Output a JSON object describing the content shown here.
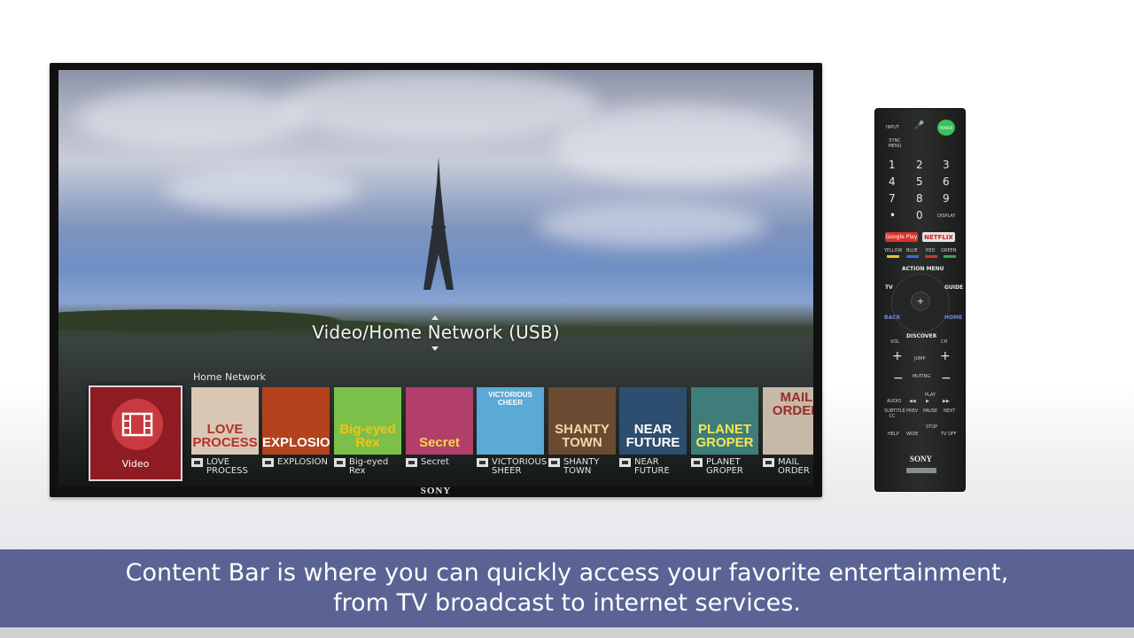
{
  "tv": {
    "screen_title": "Video/Home Network (USB)",
    "section_label": "Home Network",
    "active_tile_label": "Video",
    "brand": "SONY",
    "content_items": [
      {
        "poster_text": "LOVE PROCESS",
        "caption": "LOVE PROCESS",
        "bg": "#d9c7b5",
        "fg": "#b5302a"
      },
      {
        "poster_text": "EXPLOSION",
        "caption": "EXPLOSION",
        "bg": "#b3421d",
        "fg": "#ffffff"
      },
      {
        "poster_text": "Big-eyed Rex",
        "caption": "Big-eyed Rex",
        "bg": "#7cc04a",
        "fg": "#f4c21a"
      },
      {
        "poster_text": "Secret",
        "caption": "Secret",
        "bg": "#b23e6c",
        "fg": "#f7d44a"
      },
      {
        "poster_text": "VICTORIOUS CHEER",
        "caption": "VICTORIOUS SHEER",
        "bg": "#5aa9d6",
        "fg": "#ffffff"
      },
      {
        "poster_text": "SHANTY TOWN",
        "caption": "SHANTY TOWN",
        "bg": "#6a4a30",
        "fg": "#f1d7a6"
      },
      {
        "poster_text": "NEAR FUTURE",
        "caption": "NEAR FUTURE",
        "bg": "#2d4e6e",
        "fg": "#ffffff"
      },
      {
        "poster_text": "PLANET GROPER",
        "caption": "PLANET GROPER",
        "bg": "#3e7d7a",
        "fg": "#f7e65a"
      },
      {
        "poster_text": "MAIL ORDER",
        "caption": "MAIL ORDER",
        "bg": "#c7b9a8",
        "fg": "#9a2a2a"
      }
    ]
  },
  "remote": {
    "input": "INPUT",
    "sync_menu": "SYNC MENU",
    "power": "POWER",
    "digits": [
      "1",
      "2",
      "3",
      "4",
      "5",
      "6",
      "7",
      "8",
      "9",
      "•",
      "0"
    ],
    "display": "DISPLAY",
    "google_play": "Google Play",
    "netflix": "NETFLIX",
    "color_labels": [
      "YELLOW",
      "BLUE",
      "RED",
      "GREEN"
    ],
    "color_values": [
      "#e2c32b",
      "#3e6bd0",
      "#d83232",
      "#37a64a"
    ],
    "action_menu": "ACTION MENU",
    "tv": "TV",
    "guide": "GUIDE",
    "back": "BACK",
    "home": "HOME",
    "discover": "DISCOVER",
    "vol": "VOL",
    "ch": "CH",
    "jump": "JUMP",
    "muting": "MUTING",
    "play": "PLAY",
    "audio": "AUDIO",
    "subtitle_cc": "SUBTITLE CC",
    "prev": "PREV",
    "pause": "PAUSE",
    "next": "NEXT",
    "help": "HELP",
    "wide": "WIDE",
    "stop": "STOP",
    "tv_off": "TV OFF",
    "brand": "SONY"
  },
  "caption": {
    "line1": "Content Bar is where you can quickly access your favorite entertainment,",
    "line2": "from TV broadcast to internet services."
  }
}
